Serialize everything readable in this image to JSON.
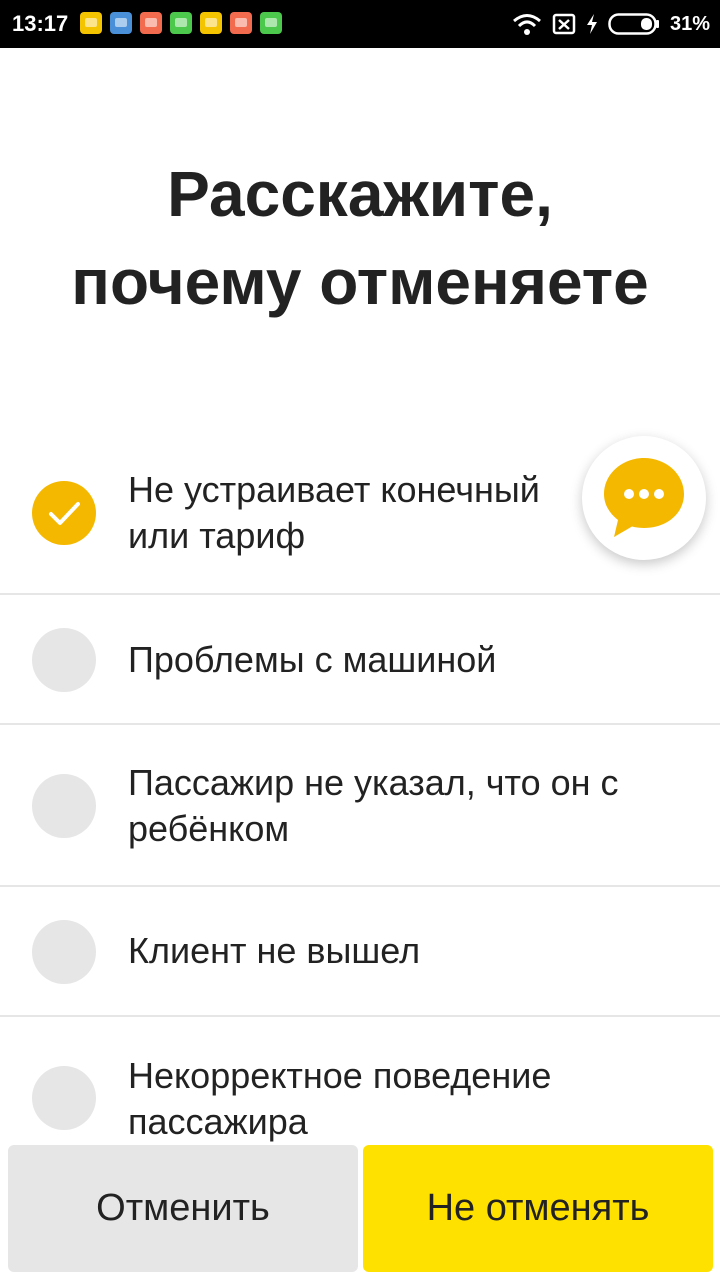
{
  "status_bar": {
    "time": "13:17",
    "battery": "31%",
    "icons": [
      "wifi-icon",
      "sim-none-icon",
      "charging-icon",
      "battery-icon"
    ],
    "notification_colors": [
      "#f5c400",
      "#4a90d9",
      "#f26b4f",
      "#4cc94c",
      "#f5c400",
      "#f26b4f",
      "#4cc94c"
    ]
  },
  "header": {
    "title_line1": "Расскажите,",
    "title_line2": "почему отменяете"
  },
  "options": [
    {
      "label": "Не устраивает конечный",
      "label_line2": "или тариф",
      "selected": true
    },
    {
      "label": "Проблемы с машиной",
      "selected": false
    },
    {
      "label": "Пассажир не указал, что он с ребёнком",
      "selected": false
    },
    {
      "label": "Клиент не вышел",
      "selected": false
    },
    {
      "label": "Некорректное поведение пассажира",
      "selected": false
    }
  ],
  "chat_button": {
    "icon": "chat-bubble-icon",
    "color": "#f5b800"
  },
  "footer": {
    "cancel_label": "Отменить",
    "keep_label": "Не отменять"
  },
  "colors": {
    "accent": "#f5b800",
    "primary_button": "#ffe100",
    "secondary_button": "#e6e6e6",
    "text": "#222222"
  }
}
